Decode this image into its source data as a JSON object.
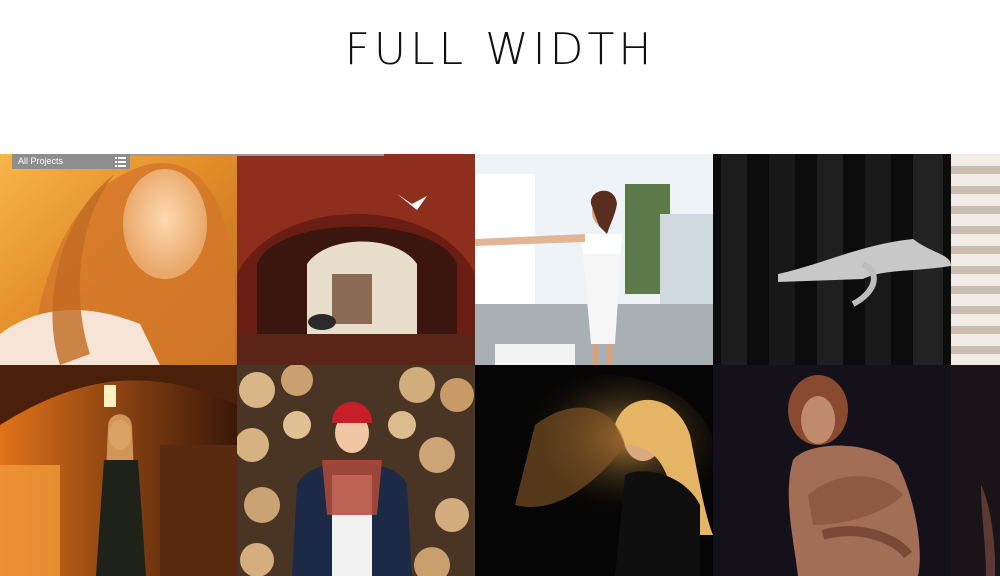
{
  "page": {
    "title": "FULL WIDTH"
  },
  "filter": {
    "label": "All Projects",
    "icon": "list-menu-icon"
  },
  "gallery": {
    "rows": [
      {
        "tiles": [
          {
            "name": "portrait-golden-hair",
            "palette": [
              "#f2a33a",
              "#ffd27a",
              "#c9782d"
            ]
          },
          {
            "name": "brick-archway-dove",
            "palette": [
              "#7a2417",
              "#c25a3d",
              "#e9d8c4"
            ]
          },
          {
            "name": "white-dress-dancer",
            "palette": [
              "#eef4f8",
              "#bcd0db",
              "#5a7a4a"
            ]
          },
          {
            "name": "dark-panel-figure",
            "palette": [
              "#0d0d0d",
              "#2a2a2a",
              "#bdbdbd"
            ]
          },
          {
            "name": "building-facade",
            "palette": [
              "#e9e3dc",
              "#c9bfb2",
              "#f6f2ee"
            ]
          }
        ]
      },
      {
        "tiles": [
          {
            "name": "corridor-black-dress",
            "palette": [
              "#c85d12",
              "#ffb14a",
              "#3a1a0a"
            ]
          },
          {
            "name": "woodpile-red-hat",
            "palette": [
              "#b98a5a",
              "#e4c79a",
              "#1f2a44"
            ]
          },
          {
            "name": "dust-hair-portrait",
            "palette": [
              "#050505",
              "#c88a3a",
              "#f0c070"
            ]
          },
          {
            "name": "figure-dark-studio",
            "palette": [
              "#141014",
              "#8a5e4a",
              "#c08a70"
            ]
          },
          {
            "name": "dark-edge",
            "palette": [
              "#1a1418",
              "#2a2226",
              "#0f0c0e"
            ]
          }
        ]
      }
    ]
  }
}
